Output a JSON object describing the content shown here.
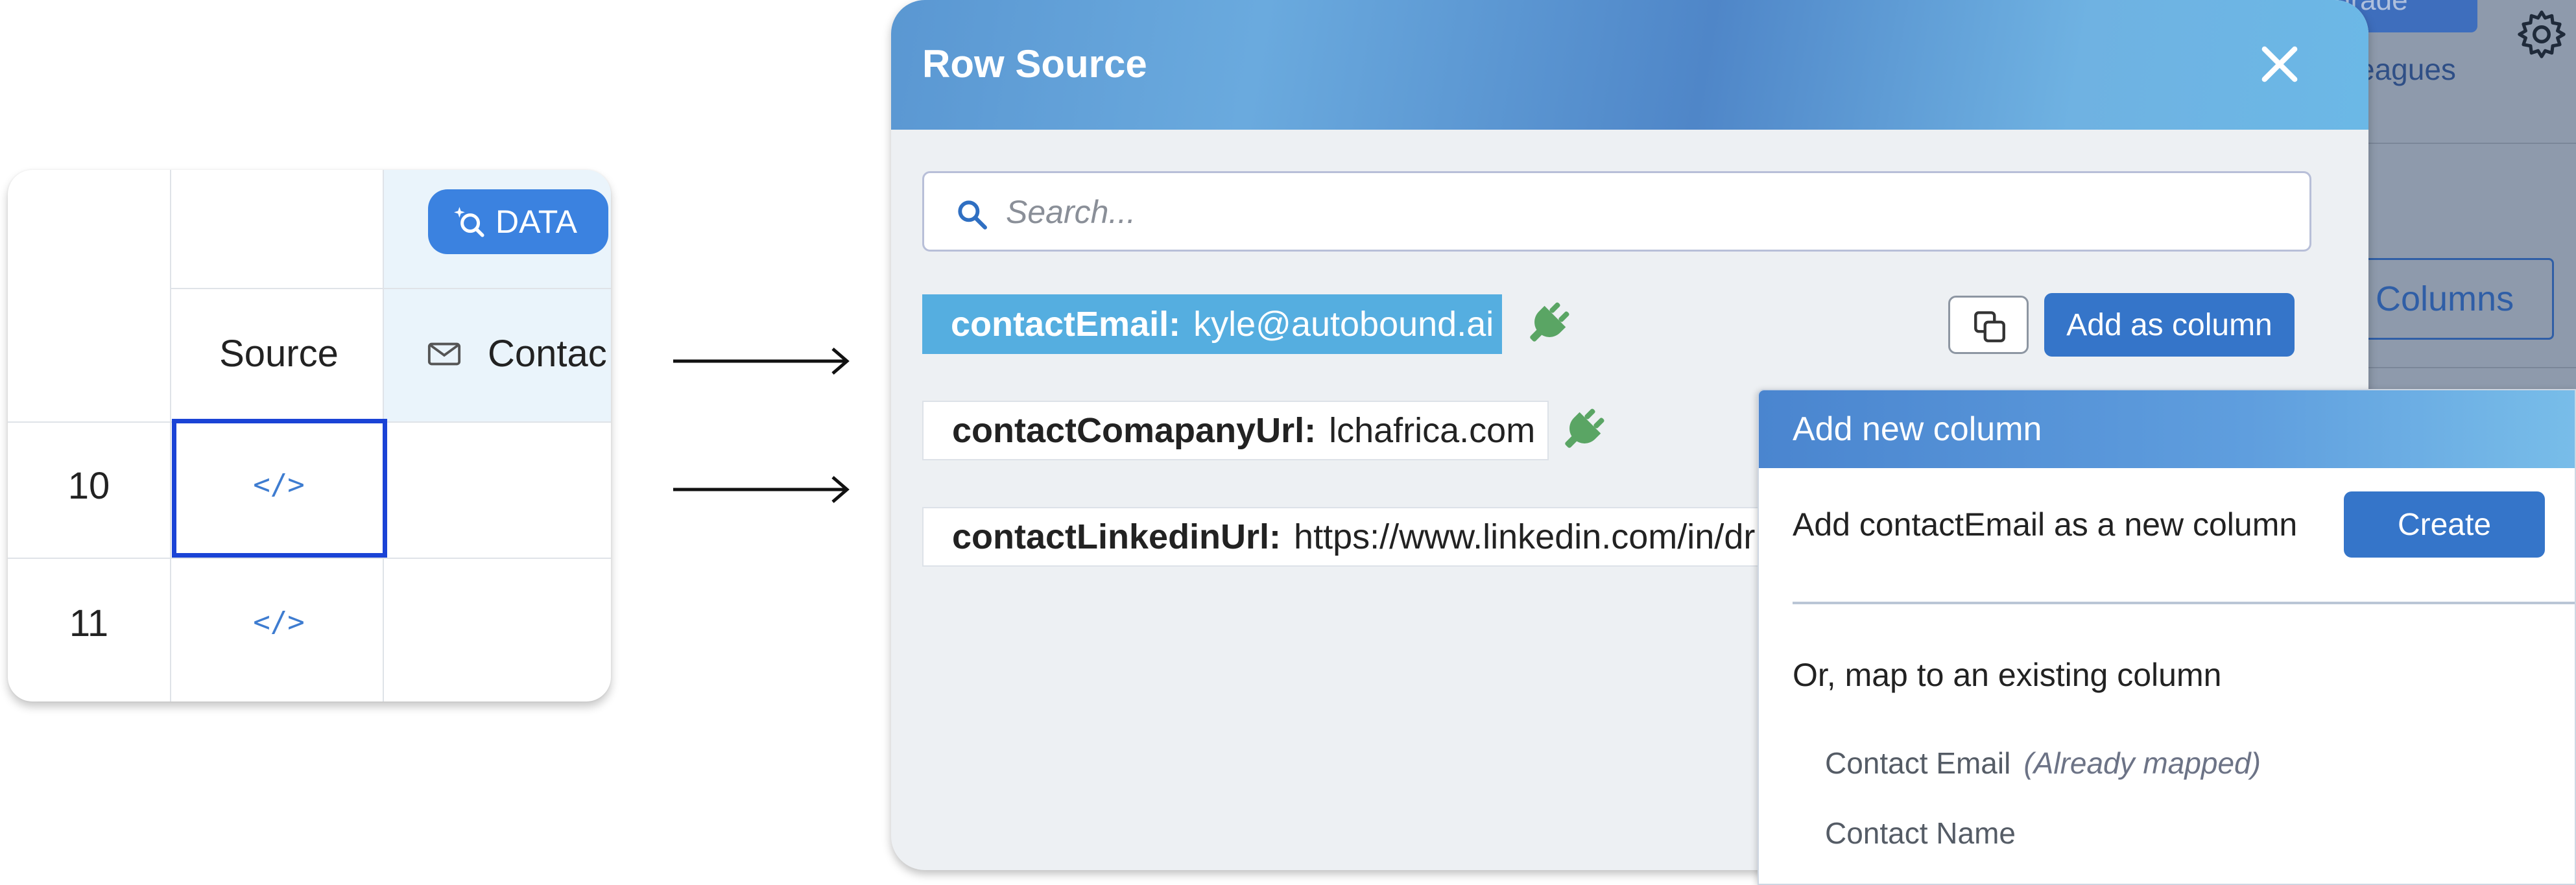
{
  "table": {
    "data_badge": "DATA",
    "columns": {
      "source": "Source",
      "contact": "Contac"
    },
    "rows": [
      {
        "num": "10",
        "source_cell": "</>"
      },
      {
        "num": "11",
        "source_cell": "</>"
      }
    ],
    "icons": {
      "data_badge": "search-sparkle-icon",
      "contact_header": "envelope-icon"
    }
  },
  "background_app": {
    "upgrade_label": "grade",
    "colleagues_link": "eagues",
    "columns_button": "Columns",
    "icons": {
      "settings": "gear-icon"
    }
  },
  "modal": {
    "title": "Row Source",
    "search": {
      "placeholder": "Search...",
      "value": ""
    },
    "fields": [
      {
        "key": "contactEmail:",
        "value": "kyle@autobound.ai",
        "highlighted": true
      },
      {
        "key": "contactComapanyUrl:",
        "value": "lchafrica.com",
        "highlighted": false
      },
      {
        "key": "contactLinkedinUrl:",
        "value": "https://www.linkedin.com/in/dr",
        "highlighted": false
      }
    ],
    "add_as_column_label": "Add as column",
    "icons": {
      "close": "close-icon",
      "search": "search-icon",
      "copy": "copy-icon",
      "connector": "plug-icon"
    }
  },
  "popover": {
    "title": "Add new column",
    "description": "Add contactEmail as a new column",
    "create_label": "Create",
    "map_prompt": "Or, map to an existing column",
    "options": [
      {
        "label": "Contact Email",
        "note": "(Already mapped)"
      },
      {
        "label": "Contact Name",
        "note": ""
      }
    ]
  },
  "colors": {
    "accent": "#3575c9",
    "highlight_field": "#55aee0",
    "selection_border": "#1a43d6",
    "plug_green": "#5aa564"
  }
}
